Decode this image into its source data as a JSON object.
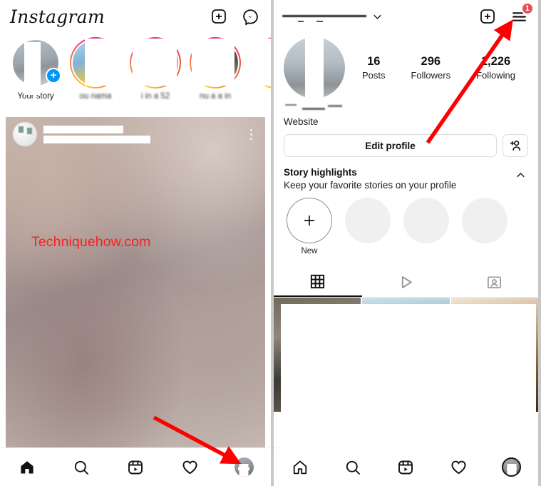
{
  "left_screen": {
    "name": "instagram-feed",
    "topbar": {
      "wordmark": "Instagram",
      "add_icon": "plus-square-icon",
      "messenger_icon": "messenger-icon"
    },
    "stories": {
      "items": [
        {
          "label": "Your story",
          "icon": "add-story-badge",
          "has_ring": false,
          "redacted": false
        },
        {
          "label": "ou nama",
          "icon": "story-ring-icon",
          "has_ring": true,
          "redacted": true
        },
        {
          "label": "i in a 52",
          "icon": "story-ring-icon",
          "has_ring": true,
          "redacted": true
        },
        {
          "label": "nu a a in",
          "icon": "story-ring-icon",
          "has_ring": true,
          "redacted": true
        },
        {
          "label": "",
          "icon": "story-ring-icon",
          "has_ring": true,
          "redacted": true
        }
      ]
    },
    "post": {
      "author_redacted": true,
      "menu_icon": "more-options-icon",
      "avatar_icon": "post-author-avatar",
      "watermark": "Techniquehow.com",
      "watermark_color": "#ff1f1f"
    },
    "bottom_nav": {
      "items": [
        {
          "label": "Home",
          "icon": "home-icon-filled",
          "active": true
        },
        {
          "label": "Search",
          "icon": "search-icon",
          "active": false
        },
        {
          "label": "Reels",
          "icon": "reels-icon",
          "active": false
        },
        {
          "label": "Activity",
          "icon": "heart-icon",
          "active": false
        },
        {
          "label": "Profile",
          "icon": "profile-avatar-icon",
          "active": false
        }
      ]
    },
    "annotation": {
      "arrow": "red-arrow-to-profile-tab",
      "color": "#ff0000"
    }
  },
  "right_screen": {
    "name": "instagram-profile",
    "topbar": {
      "username_redacted": true,
      "chevron_icon": "chevron-down-icon",
      "add_icon": "plus-square-icon",
      "menu_icon": "hamburger-menu-icon",
      "badge_count": "1",
      "badge_color": "#ed4956"
    },
    "profile": {
      "avatar_icon": "profile-avatar",
      "stats": [
        {
          "value": "16",
          "label": "Posts"
        },
        {
          "value": "296",
          "label": "Followers"
        },
        {
          "value": "1,226",
          "label": "Following"
        }
      ],
      "bio_redacted": true,
      "website_label": "Website"
    },
    "actions": {
      "edit_profile_label": "Edit profile",
      "add_person_icon": "add-person-icon"
    },
    "story_highlights": {
      "title": "Story highlights",
      "subtitle": "Keep your favorite stories on your profile",
      "collapse_icon": "chevron-up-icon",
      "new_label": "New",
      "new_icon": "plus-icon",
      "placeholder_count": 3
    },
    "tabs": [
      {
        "label": "Grid",
        "icon": "grid-icon",
        "active": true
      },
      {
        "label": "Reels",
        "icon": "play-triangle-icon",
        "active": false
      },
      {
        "label": "Tagged",
        "icon": "tagged-person-icon",
        "active": false
      }
    ],
    "grid": {
      "redacted": true,
      "cells": 3
    },
    "bottom_nav": {
      "items": [
        {
          "label": "Home",
          "icon": "home-icon-outline",
          "active": false
        },
        {
          "label": "Search",
          "icon": "search-icon",
          "active": false
        },
        {
          "label": "Reels",
          "icon": "reels-icon",
          "active": false
        },
        {
          "label": "Activity",
          "icon": "heart-icon",
          "active": false
        },
        {
          "label": "Profile",
          "icon": "profile-avatar-icon",
          "active": true
        }
      ]
    },
    "annotation": {
      "arrow": "red-arrow-to-hamburger-menu",
      "color": "#ff0000"
    }
  }
}
